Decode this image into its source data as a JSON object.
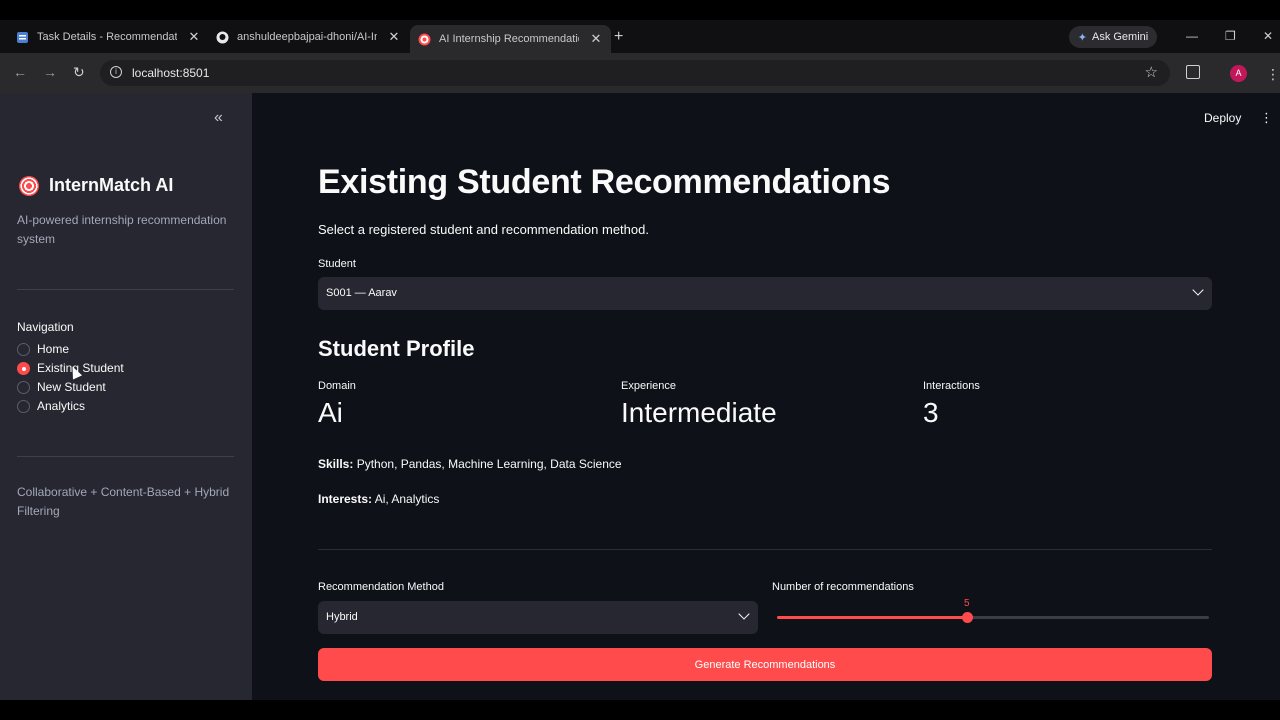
{
  "browser": {
    "tabs": [
      {
        "title": "Task Details - Recommendation",
        "icon": "document-icon"
      },
      {
        "title": "anshuldeepbajpai-dhoni/AI-Inte",
        "icon": "github-icon"
      },
      {
        "title": "AI Internship Recommendation",
        "icon": "target-icon",
        "active": true
      }
    ],
    "new_tab": "+",
    "ask_gemini": "Ask Gemini",
    "url": "localhost:8501",
    "profile_initial": "A"
  },
  "sidebar": {
    "brand": "InternMatch AI",
    "tagline": "AI-powered internship recommendation system",
    "nav_title": "Navigation",
    "nav_items": [
      {
        "label": "Home",
        "selected": false
      },
      {
        "label": "Existing Student",
        "selected": true
      },
      {
        "label": "New Student",
        "selected": false
      },
      {
        "label": "Analytics",
        "selected": false
      }
    ],
    "footnote": "Collaborative + Content-Based + Hybrid Filtering"
  },
  "header": {
    "deploy": "Deploy"
  },
  "main": {
    "title": "Existing Student Recommendations",
    "subtitle": "Select a registered student and recommendation method.",
    "student_label": "Student",
    "student_value": "S001 — Aarav",
    "profile_title": "Student Profile",
    "metrics": [
      {
        "label": "Domain",
        "value": "Ai"
      },
      {
        "label": "Experience",
        "value": "Intermediate"
      },
      {
        "label": "Interactions",
        "value": "3"
      }
    ],
    "skills_label": "Skills:",
    "skills_value": "Python, Pandas, Machine Learning, Data Science",
    "interests_label": "Interests:",
    "interests_value": "Ai, Analytics",
    "method_label": "Recommendation Method",
    "method_value": "Hybrid",
    "count_label": "Number of recommendations",
    "count_value": "5",
    "count_fraction": 0.44,
    "generate_button": "Generate Recommendations"
  },
  "colors": {
    "accent": "#ff4b4b",
    "sidebar_bg": "#262730",
    "main_bg": "#0e1117"
  }
}
